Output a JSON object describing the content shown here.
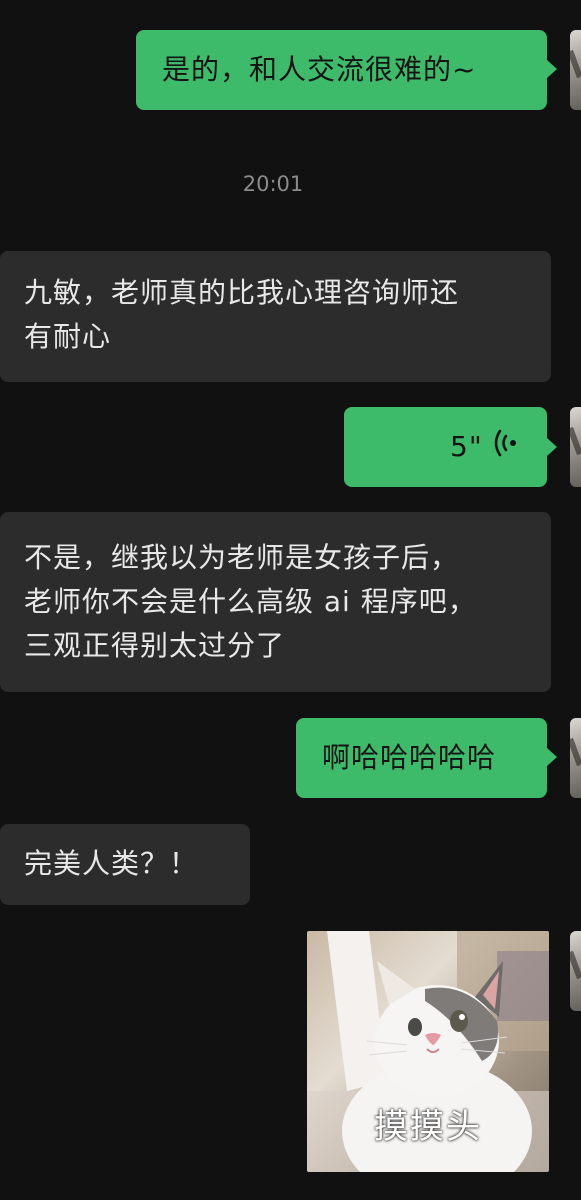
{
  "messages": [
    {
      "side": "right",
      "text": "是的，和人交流很难的~"
    },
    {
      "type": "timestamp",
      "text": "20:01"
    },
    {
      "side": "left",
      "lines": [
        "九敏，老师真的比我心理咨询师还",
        "有耐心"
      ]
    },
    {
      "side": "right",
      "type": "voice",
      "duration": "5\""
    },
    {
      "side": "left",
      "lines": [
        "不是，继我以为老师是女孩子后，",
        "老师你不会是什么高级 ai 程序吧，",
        "三观正得别太过分了"
      ]
    },
    {
      "side": "right",
      "text": "啊哈哈哈哈哈"
    },
    {
      "side": "left",
      "text": "完美人类？！"
    },
    {
      "side": "right",
      "type": "sticker",
      "caption": "摸摸头"
    }
  ],
  "colors": {
    "background": "#111111",
    "sent_bubble": "#3dbb6b",
    "received_bubble": "#2c2c2c",
    "timestamp": "#8b8b8b"
  },
  "icons": {
    "voice": "voice-wave-icon",
    "avatar": "user-avatar"
  }
}
